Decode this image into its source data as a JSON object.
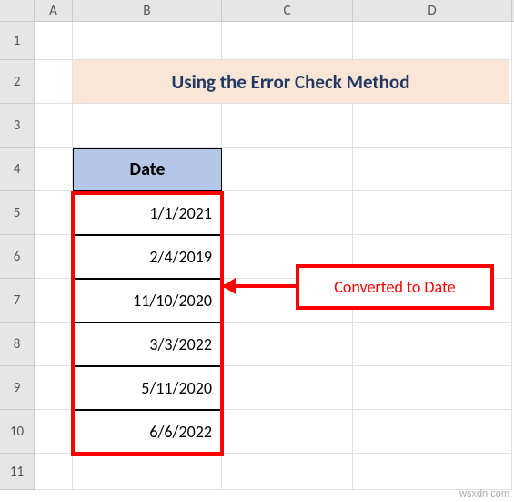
{
  "columns": {
    "a": "A",
    "b": "B",
    "c": "C",
    "d": "D"
  },
  "rows": {
    "r1": "1",
    "r2": "2",
    "r3": "3",
    "r4": "4",
    "r5": "5",
    "r6": "6",
    "r7": "7",
    "r8": "8",
    "r9": "9",
    "r10": "10",
    "r11": "11"
  },
  "title": "Using the Error Check Method",
  "table": {
    "header": "Date",
    "data": [
      "1/1/2021",
      "2/4/2019",
      "11/10/2020",
      "3/3/2022",
      "5/11/2020",
      "6/6/2022"
    ]
  },
  "callout": "Converted to Date",
  "watermark": "wsxdn.com"
}
